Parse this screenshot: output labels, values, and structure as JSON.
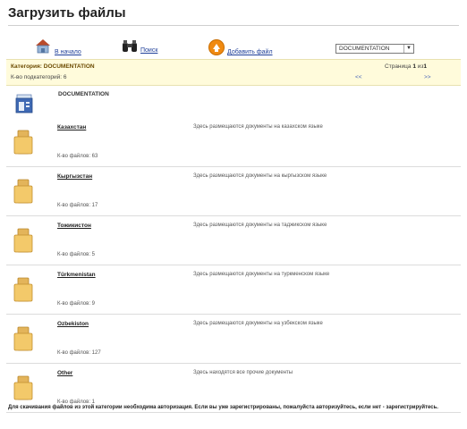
{
  "header": {
    "title": "Загрузить файлы"
  },
  "toolbar": {
    "home_label": "В начало",
    "search_label": "Поиск",
    "add_label": "Добавить файл",
    "category_select_value": "DOCUMENTATION"
  },
  "category_bar": {
    "category": "Категория: DOCUMENTATION",
    "subcategories": "К-во подкатегорий: 6",
    "page_label": "Страница",
    "page_current": "1",
    "page_of": "из",
    "page_total": "1",
    "prev": "<<",
    "next": ">>"
  },
  "current_folder": {
    "label": "DOCUMENTATION"
  },
  "folders": [
    {
      "name": "Казахстан",
      "description": "Здесь размещаются документы на казахском языке",
      "count": "К-во файлов: 63"
    },
    {
      "name": "Кыргызстан",
      "description": "Здесь размещаются документы на кыргызском языке",
      "count": "К-во файлов: 17"
    },
    {
      "name": "Тожикистон",
      "description": "Здесь размещаются документы на таджикском языке",
      "count": "К-во файлов: 5"
    },
    {
      "name": "Türkmenistan",
      "description": "Здесь размещаются документы на туркменском языке",
      "count": "К-во файлов: 9"
    },
    {
      "name": "Ozbekiston",
      "description": "Здесь размещаются документы на узбекском языке",
      "count": "К-во файлов: 127"
    },
    {
      "name": "Other",
      "description": "Здесь находятся все прочие документы",
      "count": "К-во файлов: 1"
    }
  ],
  "footer": {
    "notice": "Для скачивания файлов из этой категории необходима авторизация. Если вы уже зарегистрированы, пожалуйста авторизуйтесь, если нет - зарегистрируйтесь."
  }
}
